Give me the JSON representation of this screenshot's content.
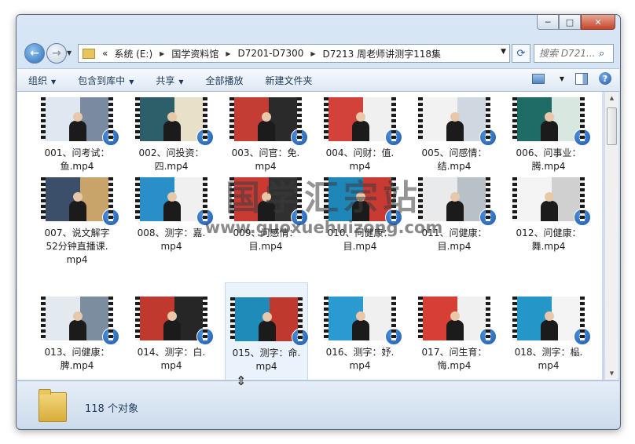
{
  "window": {
    "minimize": "─",
    "maximize": "□",
    "close": "✕"
  },
  "nav": {
    "back": "←",
    "forward": "→"
  },
  "address": {
    "prefix": "«",
    "crumbs": [
      "系统 (E:)",
      "国学资料馆",
      "D7201-D7300",
      "D7213 周老师讲测字118集"
    ]
  },
  "search": {
    "placeholder": "搜索 D721..."
  },
  "toolbar": {
    "organize": "组织",
    "include": "包含到库中",
    "share": "共享",
    "play_all": "全部播放",
    "new_folder": "新建文件夹"
  },
  "files": [
    {
      "line1": "001、问考试：",
      "line2": "鱼.mp4",
      "line3": "",
      "bg": "#dfe8f0",
      "accent": "#7a8aa0"
    },
    {
      "line1": "002、问投资：",
      "line2": "四.mp4",
      "line3": "",
      "bg": "#2c5f6a",
      "accent": "#e8e0c8"
    },
    {
      "line1": "003、问官：免.",
      "line2": "mp4",
      "line3": "",
      "bg": "#c33d34",
      "accent": "#2a2a2a"
    },
    {
      "line1": "004、问财：值.",
      "line2": "mp4",
      "line3": "",
      "bg": "#d2423a",
      "accent": "#f0f0f0"
    },
    {
      "line1": "005、问感情：",
      "line2": "结.mp4",
      "line3": "",
      "bg": "#f2f2f2",
      "accent": "#cfd8e0"
    },
    {
      "line1": "006、问事业：",
      "line2": "腾.mp4",
      "line3": "",
      "bg": "#1f6b66",
      "accent": "#d8e8e0"
    },
    {
      "line1": "007、说文解字",
      "line2": "52分钟直播课.",
      "line3": "mp4",
      "bg": "#3b4f6a",
      "accent": "#c9a46a"
    },
    {
      "line1": "008、测字：嘉.",
      "line2": "mp4",
      "line3": "",
      "bg": "#2a8fc8",
      "accent": "#f0f0f0"
    },
    {
      "line1": "009、问感情：",
      "line2": "目.mp4",
      "line3": "",
      "bg": "#c93a33",
      "accent": "#303030"
    },
    {
      "line1": "010、问健康：",
      "line2": "目.mp4",
      "line3": "",
      "bg": "#1f86b8",
      "accent": "#c93a33"
    },
    {
      "line1": "011、问健康：",
      "line2": "目.mp4",
      "line3": "",
      "bg": "#e8eaec",
      "accent": "#b8c0c8"
    },
    {
      "line1": "012、问健康：",
      "line2": "舞.mp4",
      "line3": "",
      "bg": "#f4f4f4",
      "accent": "#d0d0d0"
    },
    {
      "line1": "013、问健康：",
      "line2": "脾.mp4",
      "line3": "",
      "bg": "#e2e9ef",
      "accent": "#7d8da0"
    },
    {
      "line1": "014、测字：白.",
      "line2": "mp4",
      "line3": "",
      "bg": "#c0392f",
      "accent": "#262626"
    },
    {
      "line1": "015、测字：命.",
      "line2": "mp4",
      "line3": "",
      "bg": "#1f8bb8",
      "accent": "#c0392f"
    },
    {
      "line1": "016、测字：妤.",
      "line2": "mp4",
      "line3": "",
      "bg": "#2a9ad0",
      "accent": "#f0f0f0"
    },
    {
      "line1": "017、问生育：",
      "line2": "悔.mp4",
      "line3": "",
      "bg": "#d63f35",
      "accent": "#f0f0f0"
    },
    {
      "line1": "018、测字：榀.",
      "line2": "mp4",
      "line3": "",
      "bg": "#2596c8",
      "accent": "#f4f4f4"
    }
  ],
  "watermark": {
    "cn": "国学汇宗站",
    "url": "www.guoxuehuizong.com"
  },
  "status": {
    "count": "118 个对象"
  }
}
